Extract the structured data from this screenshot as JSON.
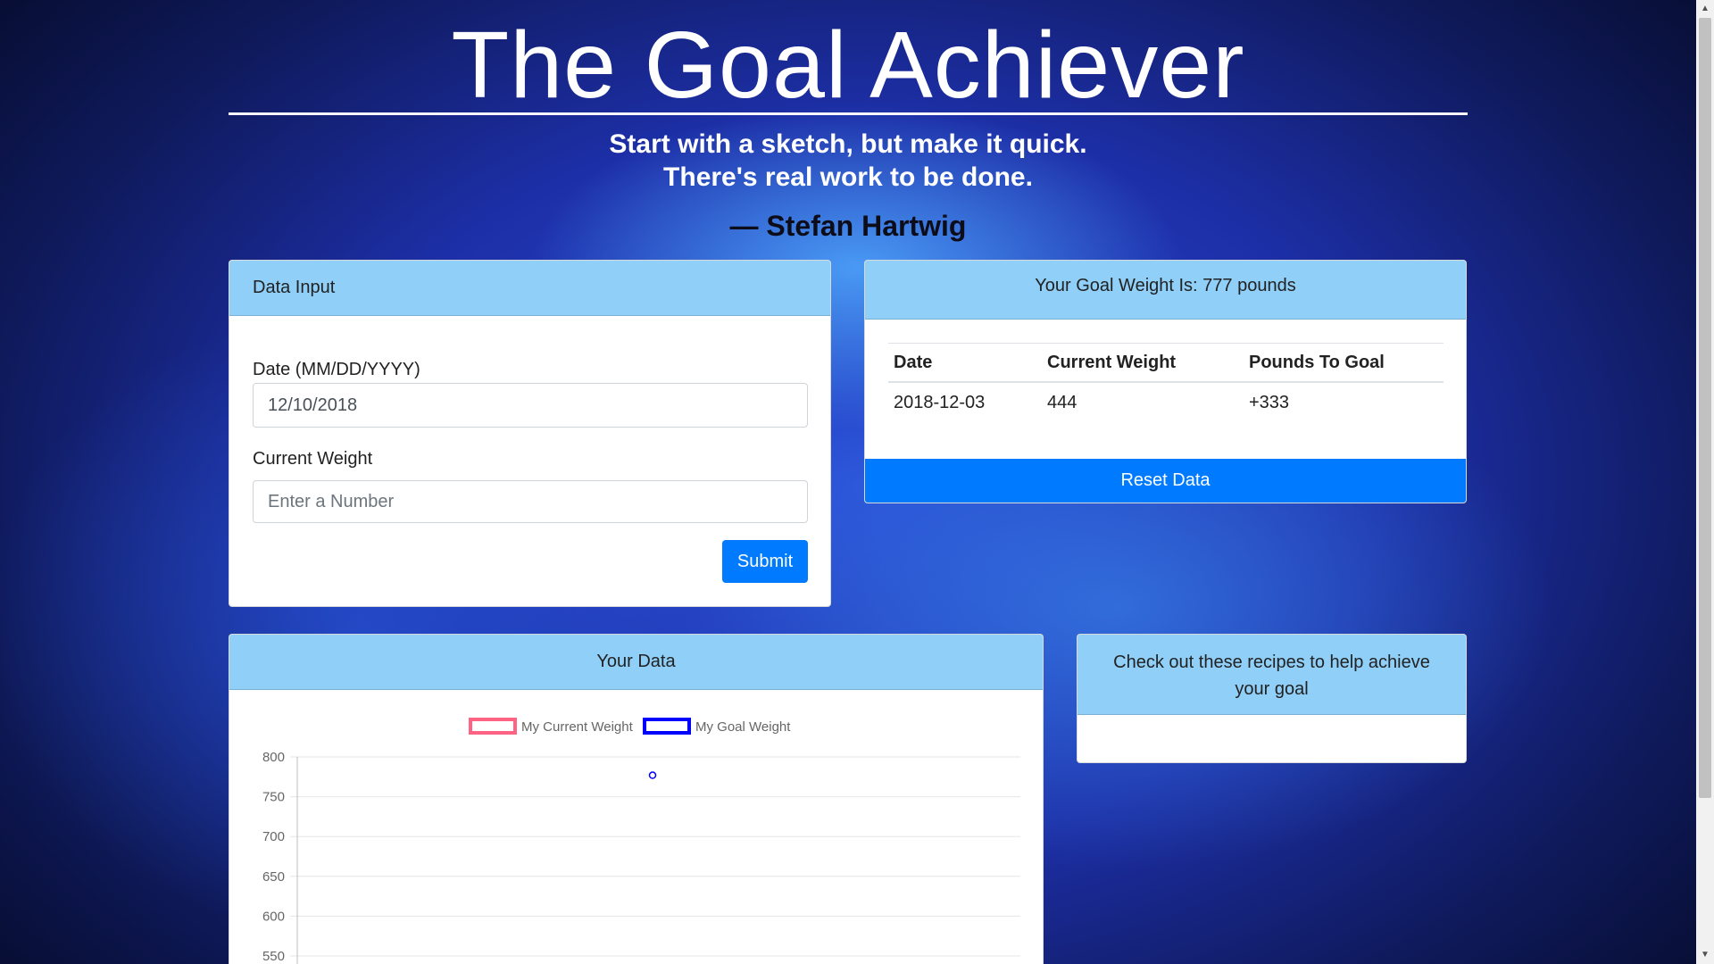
{
  "header": {
    "title": "The Goal Achiever",
    "quote_line1": "Start with a sketch, but make it quick.",
    "quote_line2": "There's real work to be done.",
    "author": "— Stefan Hartwig"
  },
  "input_card": {
    "title": "Data Input",
    "date_label": "Date (MM/DD/YYYY)",
    "date_value": "12/10/2018",
    "weight_label": "Current Weight",
    "weight_placeholder": "Enter a Number",
    "submit_label": "Submit"
  },
  "goal_card": {
    "title": "Your Goal Weight Is: 777 pounds",
    "columns": [
      "Date",
      "Current Weight",
      "Pounds To Goal"
    ],
    "rows": [
      [
        "2018-12-03",
        "444",
        "+333"
      ]
    ],
    "reset_label": "Reset Data"
  },
  "chart_card": {
    "title": "Your Data"
  },
  "recipes_card": {
    "title": "Check out these recipes to help achieve your goal"
  },
  "colors": {
    "card_header": "#8fcff8",
    "primary_button": "#007bff",
    "current_weight_series": "#ff6384",
    "goal_weight_series": "#0000ff"
  },
  "chart_data": {
    "type": "line",
    "series": [
      {
        "name": "My Current Weight",
        "points": []
      },
      {
        "name": "My Goal Weight",
        "points": [
          777
        ]
      }
    ],
    "y_ticks": [
      800,
      750,
      700,
      650,
      600,
      550
    ],
    "ylim": [
      550,
      800
    ],
    "grid": true,
    "legend": "top"
  }
}
